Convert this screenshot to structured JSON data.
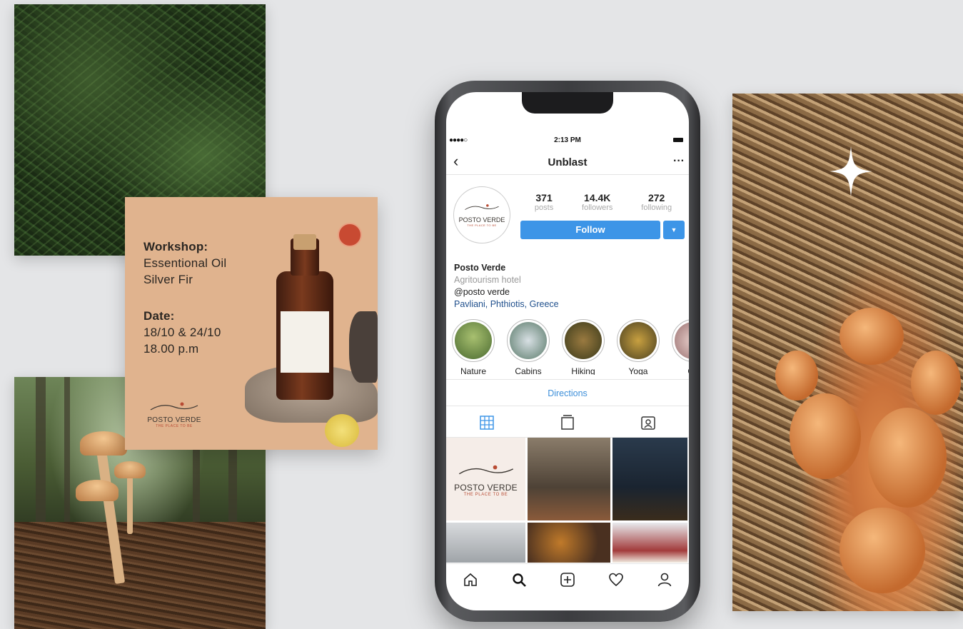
{
  "workshop": {
    "heading1": "Workshop:",
    "line1": "Essentional Oil",
    "line2": "Silver Fir",
    "heading2": "Date:",
    "date": "18/10 & 24/10",
    "time": "18.00 p.m",
    "brand_name": "POSTO VERDE",
    "brand_tagline": "THE PLACE TO BE"
  },
  "status_bar": {
    "signal": "●●●●○",
    "time": "2:13 PM"
  },
  "nav": {
    "title": "Unblast",
    "back_glyph": "‹",
    "more_glyph": "···"
  },
  "profile": {
    "avatar_name": "POSTO VERDE",
    "avatar_tagline": "THE PLACE TO BE",
    "stats": [
      {
        "value": "371",
        "label": "posts"
      },
      {
        "value": "14.4K",
        "label": "followers"
      },
      {
        "value": "272",
        "label": "following"
      }
    ],
    "follow_label": "Follow",
    "caret_glyph": "▼",
    "name": "Posto Verde",
    "category": "Agritourism hotel",
    "handle": "@posto verde",
    "location": "Pavliani, Phthiotis, Greece"
  },
  "highlights": [
    {
      "label": "Nature",
      "color": "#6f8a4a"
    },
    {
      "label": "Cabins",
      "color": "#8aa0a8"
    },
    {
      "label": "Hiking",
      "color": "#6a5a2e"
    },
    {
      "label": "Yoga",
      "color": "#7a6a2a"
    },
    {
      "label": "Co",
      "color": "#c9a6a0"
    }
  ],
  "directions_label": "Directions",
  "tabs": [
    "grid-icon",
    "tv-icon",
    "tagged-icon"
  ],
  "grid_post": {
    "brand_name": "POSTO VERDE",
    "brand_tagline": "THE PLACE TO BE"
  },
  "tabbar": [
    "home-icon",
    "search-icon",
    "add-icon",
    "heart-icon",
    "profile-icon"
  ],
  "colors": {
    "accent_blue": "#3d95e7",
    "brand_red": "#b84b33",
    "link_blue": "#1f4f8c"
  }
}
